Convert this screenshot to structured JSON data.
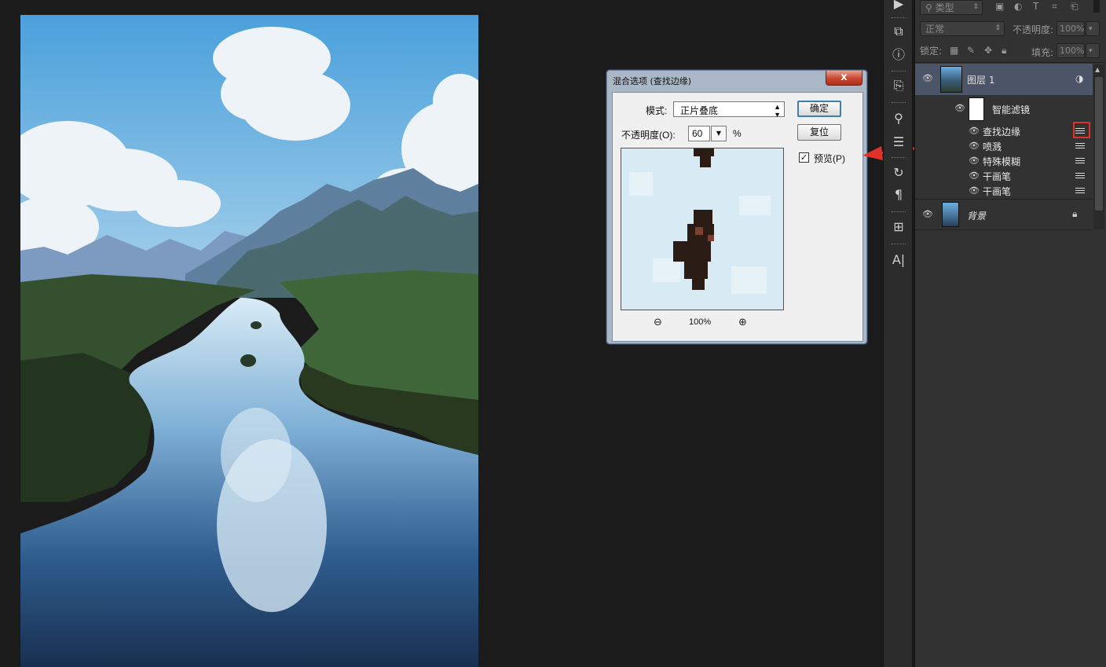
{
  "dialog": {
    "title": "混合选项 (查找边缘)",
    "close": "x",
    "mode_label": "模式:",
    "mode_value": "正片叠底",
    "opacity_label": "不透明度(O):",
    "opacity_value": "60",
    "opacity_unit": "%",
    "ok": "确定",
    "reset": "复位",
    "preview_label": "预览(P)",
    "preview_checked": true,
    "zoom": "100%"
  },
  "layers_panel": {
    "filter_kind": "类型",
    "blend_mode": "正常",
    "opacity_label": "不透明度:",
    "opacity_value": "100%",
    "lock_label": "锁定:",
    "fill_label": "填充:",
    "fill_value": "100%",
    "layers": [
      {
        "name": "图层 1",
        "selected": true,
        "smart_filters_label": "智能滤镜",
        "filters": [
          "查找边缘",
          "喷溅",
          "特殊模糊",
          "干画笔",
          "干画笔"
        ]
      },
      {
        "name": "背景",
        "locked": true
      }
    ]
  },
  "colors": {
    "annotation_red": "#e0302a",
    "selected_layer": "#4c5568",
    "panel_bg": "#323232",
    "dialog_frame": "#a9b7c7"
  }
}
